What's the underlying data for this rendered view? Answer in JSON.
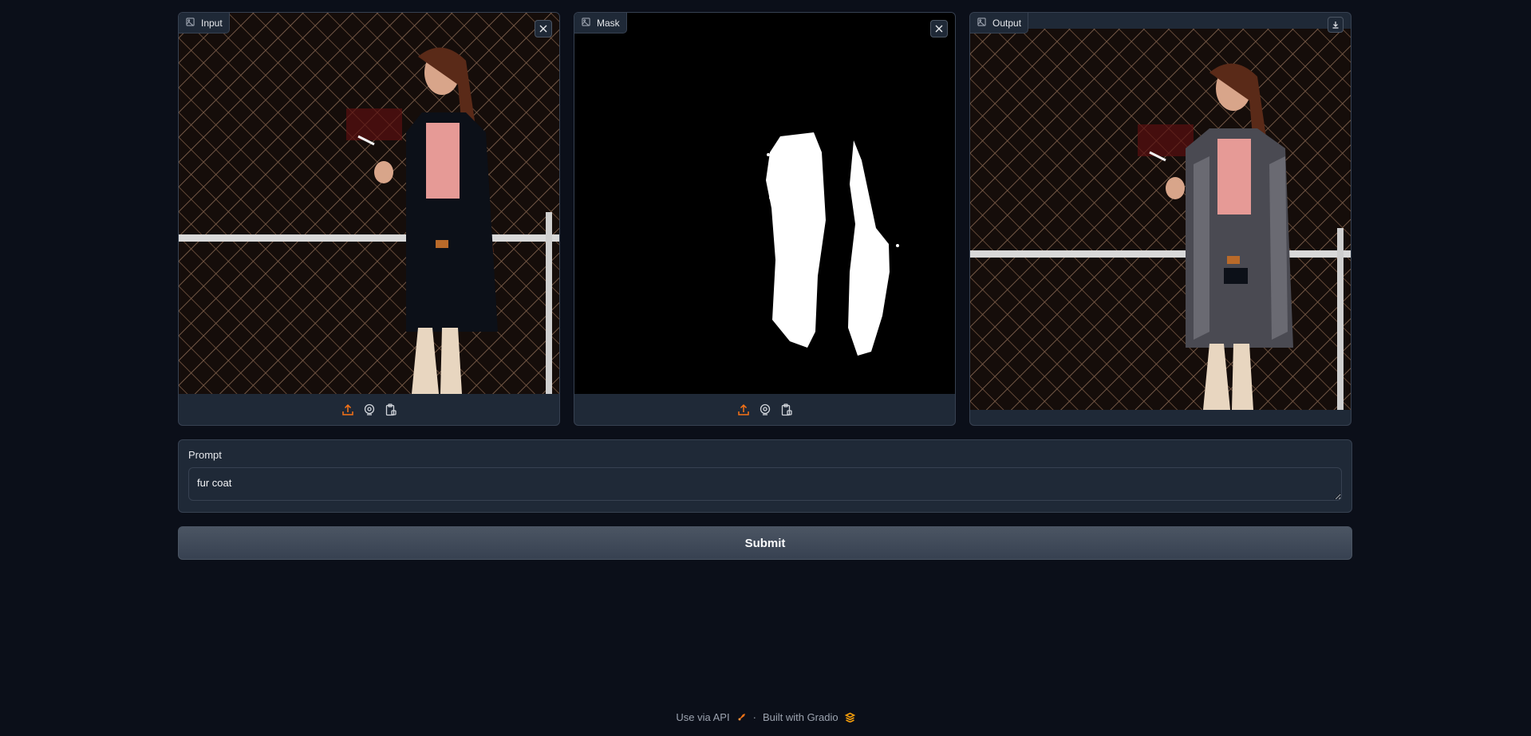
{
  "panels": {
    "input": {
      "label": "Input"
    },
    "mask": {
      "label": "Mask"
    },
    "output": {
      "label": "Output"
    }
  },
  "prompt": {
    "label": "Prompt",
    "value": "fur coat"
  },
  "submit": {
    "label": "Submit"
  },
  "footer": {
    "api_link": "Use via API",
    "separator": "·",
    "built_with": "Built with Gradio"
  },
  "icons": {
    "image": "image-icon",
    "close": "close-icon",
    "download": "download-icon",
    "upload": "upload-icon",
    "webcam": "webcam-icon",
    "clipboard": "clipboard-icon",
    "rocket": "rocket-icon",
    "gradio_logo": "gradio-logo-icon"
  },
  "colors": {
    "accent": "#f97316",
    "background": "#0b0f19",
    "panel": "#1f2937",
    "border": "#374151",
    "button": "#4b5563"
  }
}
